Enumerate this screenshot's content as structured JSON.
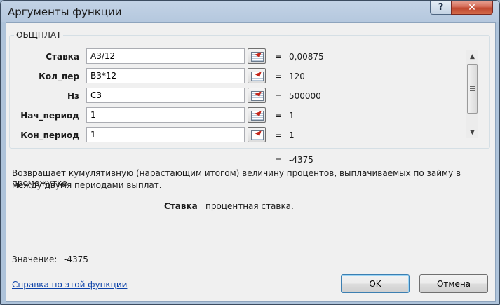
{
  "window": {
    "title": "Аргументы функции",
    "help_label": "?",
    "close_label": "✕"
  },
  "function": {
    "name": "ОБЩПЛАТ"
  },
  "args": [
    {
      "label": "Ставка",
      "input": "A3/12",
      "value": "0,00875"
    },
    {
      "label": "Кол_пер",
      "input": "B3*12",
      "value": "120"
    },
    {
      "label": "Нз",
      "input": "C3",
      "value": "500000"
    },
    {
      "label": "Нач_период",
      "input": "1",
      "value": "1"
    },
    {
      "label": "Кон_период",
      "input": "1",
      "value": "1"
    }
  ],
  "eq_sign": "=",
  "result": {
    "value": "-4375"
  },
  "description": {
    "line1": "Возвращает кумулятивную (нарастающим итогом) величину процентов, выплачиваемых по займу в промежутке",
    "line2": "между двумя периодами выплат."
  },
  "arg_help": {
    "name": "Ставка",
    "text": "процентная ставка."
  },
  "formula_value": {
    "label": "Значение:",
    "value": "-4375"
  },
  "help_link": "Справка по этой функции",
  "buttons": {
    "ok": "OK",
    "cancel": "Отмена"
  },
  "colors": {
    "link": "#0b41a8",
    "collapse_arrow": "#c4261a",
    "close_button": "#c04730"
  }
}
